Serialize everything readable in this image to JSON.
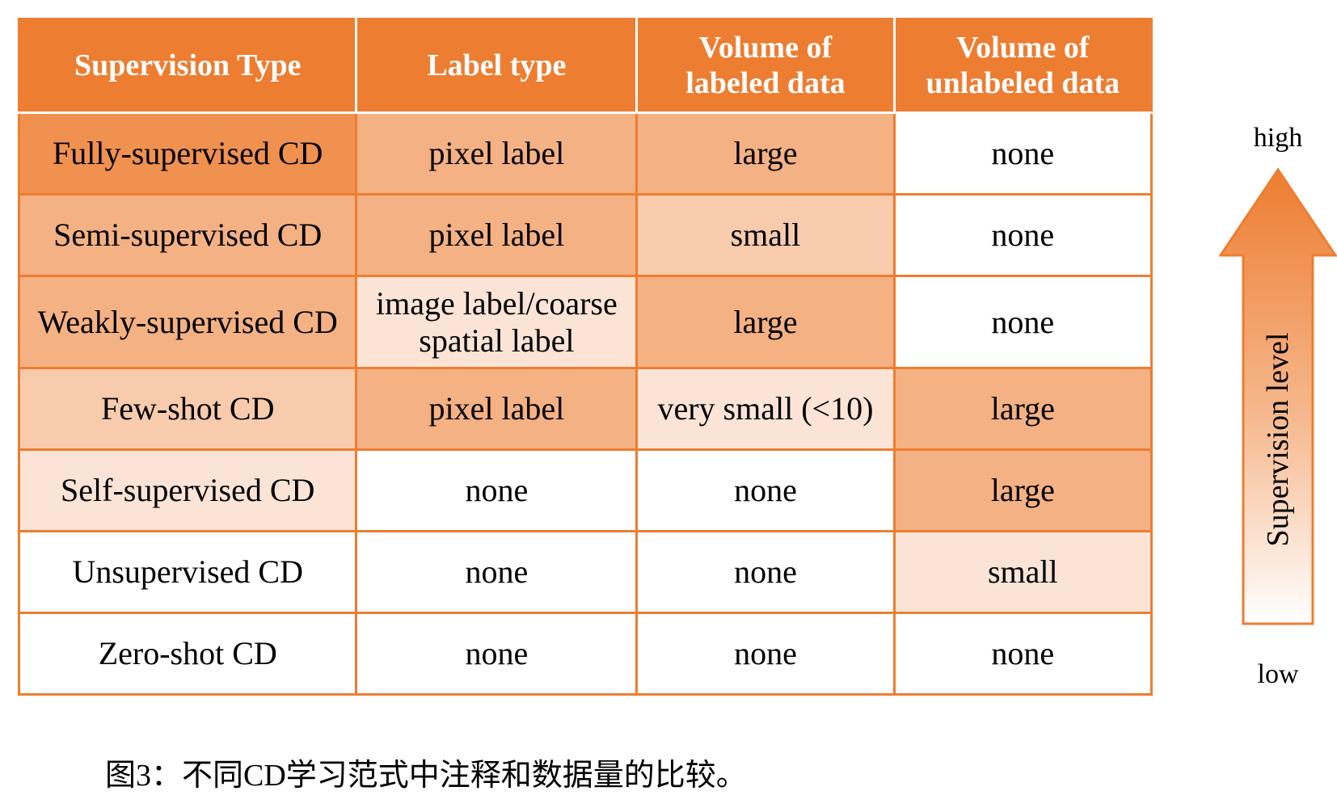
{
  "table": {
    "headers": {
      "supervision_type": "Supervision Type",
      "label_type": "Label type",
      "labeled_line1": "Volume of",
      "labeled_line2": "labeled data",
      "unlabeled_line1": "Volume of",
      "unlabeled_line2": "unlabeled data"
    },
    "rows": [
      {
        "type": "Fully-supervised  CD",
        "label": "pixel label",
        "label_line2": "",
        "labeled": "large",
        "unlabeled": "none"
      },
      {
        "type": "Semi-supervised CD",
        "label": "pixel label",
        "label_line2": "",
        "labeled": "small",
        "unlabeled": "none"
      },
      {
        "type": "Weakly-supervised CD",
        "label": "image label/coarse",
        "label_line2": "spatial label",
        "labeled": "large",
        "unlabeled": "none"
      },
      {
        "type": "Few-shot CD",
        "label": "pixel label",
        "label_line2": "",
        "labeled": "very small (<10)",
        "unlabeled": "large"
      },
      {
        "type": "Self-supervised CD",
        "label": "none",
        "label_line2": "",
        "labeled": "none",
        "unlabeled": "large"
      },
      {
        "type": "Unsupervised CD",
        "label": "none",
        "label_line2": "",
        "labeled": "none",
        "unlabeled": "small"
      },
      {
        "type": "Zero-shot CD",
        "label": "none",
        "label_line2": "",
        "labeled": "none",
        "unlabeled": "none"
      }
    ]
  },
  "colors": {
    "header": "#ed7d31",
    "shade_strong": "#f0914f",
    "shade_medium": "#f4b183",
    "shade_light": "#f8cbad",
    "shade_faint": "#fbe4d6",
    "border": "#ed7d31"
  },
  "arrow": {
    "high": "high",
    "low": "low",
    "axis_label": "Supervision level"
  },
  "caption": "图3：不同CD学习范式中注释和数据量的比较。"
}
